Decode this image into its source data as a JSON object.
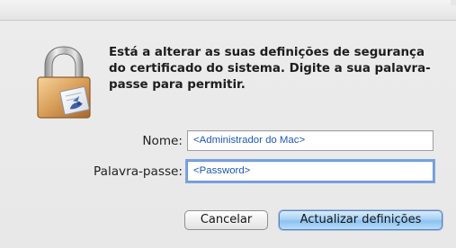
{
  "dialog": {
    "icon": "padlock-with-certificate-icon",
    "message": "Está a alterar as suas definições de segurança do certificado do sistema. Digite a sua palavra-passe para permitir."
  },
  "form": {
    "name_label": "Nome:",
    "name_value": "<Administrador do Mac>",
    "password_label": "Palavra-passe:",
    "password_value": "<Password>"
  },
  "buttons": {
    "cancel": "Cancelar",
    "confirm": "Actualizar definições"
  },
  "colors": {
    "field_text": "#1d57b9",
    "focus_ring": "#5c8edc",
    "default_button": "#8dc2ef"
  }
}
